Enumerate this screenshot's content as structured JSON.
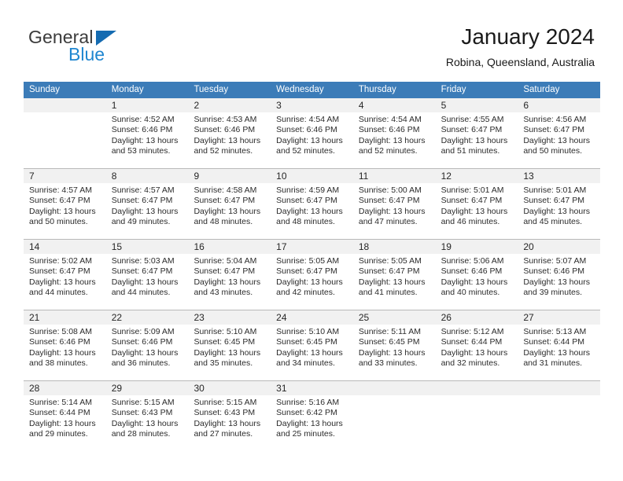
{
  "brand": {
    "word_one": "General",
    "word_two": "Blue",
    "triangle_icon": "blue-triangle-icon",
    "accent_color": "#1f86d0"
  },
  "header": {
    "title": "January 2024",
    "location": "Robina, Queensland, Australia"
  },
  "theme": {
    "header_row_bg": "#3c7cb8",
    "daynum_bg": "#f1f1f1",
    "grid_line": "#b9b9b9",
    "text": "#2b2b2b"
  },
  "weekdays": [
    "Sunday",
    "Monday",
    "Tuesday",
    "Wednesday",
    "Thursday",
    "Friday",
    "Saturday"
  ],
  "weeks": [
    {
      "days": [
        {
          "num": "",
          "sunrise": "",
          "sunset": "",
          "daylight_line1": "",
          "daylight_line2": "",
          "empty": true
        },
        {
          "num": "1",
          "sunrise": "Sunrise: 4:52 AM",
          "sunset": "Sunset: 6:46 PM",
          "daylight_line1": "Daylight: 13 hours",
          "daylight_line2": "and 53 minutes."
        },
        {
          "num": "2",
          "sunrise": "Sunrise: 4:53 AM",
          "sunset": "Sunset: 6:46 PM",
          "daylight_line1": "Daylight: 13 hours",
          "daylight_line2": "and 52 minutes."
        },
        {
          "num": "3",
          "sunrise": "Sunrise: 4:54 AM",
          "sunset": "Sunset: 6:46 PM",
          "daylight_line1": "Daylight: 13 hours",
          "daylight_line2": "and 52 minutes."
        },
        {
          "num": "4",
          "sunrise": "Sunrise: 4:54 AM",
          "sunset": "Sunset: 6:46 PM",
          "daylight_line1": "Daylight: 13 hours",
          "daylight_line2": "and 52 minutes."
        },
        {
          "num": "5",
          "sunrise": "Sunrise: 4:55 AM",
          "sunset": "Sunset: 6:47 PM",
          "daylight_line1": "Daylight: 13 hours",
          "daylight_line2": "and 51 minutes."
        },
        {
          "num": "6",
          "sunrise": "Sunrise: 4:56 AM",
          "sunset": "Sunset: 6:47 PM",
          "daylight_line1": "Daylight: 13 hours",
          "daylight_line2": "and 50 minutes."
        }
      ]
    },
    {
      "days": [
        {
          "num": "7",
          "sunrise": "Sunrise: 4:57 AM",
          "sunset": "Sunset: 6:47 PM",
          "daylight_line1": "Daylight: 13 hours",
          "daylight_line2": "and 50 minutes."
        },
        {
          "num": "8",
          "sunrise": "Sunrise: 4:57 AM",
          "sunset": "Sunset: 6:47 PM",
          "daylight_line1": "Daylight: 13 hours",
          "daylight_line2": "and 49 minutes."
        },
        {
          "num": "9",
          "sunrise": "Sunrise: 4:58 AM",
          "sunset": "Sunset: 6:47 PM",
          "daylight_line1": "Daylight: 13 hours",
          "daylight_line2": "and 48 minutes."
        },
        {
          "num": "10",
          "sunrise": "Sunrise: 4:59 AM",
          "sunset": "Sunset: 6:47 PM",
          "daylight_line1": "Daylight: 13 hours",
          "daylight_line2": "and 48 minutes."
        },
        {
          "num": "11",
          "sunrise": "Sunrise: 5:00 AM",
          "sunset": "Sunset: 6:47 PM",
          "daylight_line1": "Daylight: 13 hours",
          "daylight_line2": "and 47 minutes."
        },
        {
          "num": "12",
          "sunrise": "Sunrise: 5:01 AM",
          "sunset": "Sunset: 6:47 PM",
          "daylight_line1": "Daylight: 13 hours",
          "daylight_line2": "and 46 minutes."
        },
        {
          "num": "13",
          "sunrise": "Sunrise: 5:01 AM",
          "sunset": "Sunset: 6:47 PM",
          "daylight_line1": "Daylight: 13 hours",
          "daylight_line2": "and 45 minutes."
        }
      ]
    },
    {
      "days": [
        {
          "num": "14",
          "sunrise": "Sunrise: 5:02 AM",
          "sunset": "Sunset: 6:47 PM",
          "daylight_line1": "Daylight: 13 hours",
          "daylight_line2": "and 44 minutes."
        },
        {
          "num": "15",
          "sunrise": "Sunrise: 5:03 AM",
          "sunset": "Sunset: 6:47 PM",
          "daylight_line1": "Daylight: 13 hours",
          "daylight_line2": "and 44 minutes."
        },
        {
          "num": "16",
          "sunrise": "Sunrise: 5:04 AM",
          "sunset": "Sunset: 6:47 PM",
          "daylight_line1": "Daylight: 13 hours",
          "daylight_line2": "and 43 minutes."
        },
        {
          "num": "17",
          "sunrise": "Sunrise: 5:05 AM",
          "sunset": "Sunset: 6:47 PM",
          "daylight_line1": "Daylight: 13 hours",
          "daylight_line2": "and 42 minutes."
        },
        {
          "num": "18",
          "sunrise": "Sunrise: 5:05 AM",
          "sunset": "Sunset: 6:47 PM",
          "daylight_line1": "Daylight: 13 hours",
          "daylight_line2": "and 41 minutes."
        },
        {
          "num": "19",
          "sunrise": "Sunrise: 5:06 AM",
          "sunset": "Sunset: 6:46 PM",
          "daylight_line1": "Daylight: 13 hours",
          "daylight_line2": "and 40 minutes."
        },
        {
          "num": "20",
          "sunrise": "Sunrise: 5:07 AM",
          "sunset": "Sunset: 6:46 PM",
          "daylight_line1": "Daylight: 13 hours",
          "daylight_line2": "and 39 minutes."
        }
      ]
    },
    {
      "days": [
        {
          "num": "21",
          "sunrise": "Sunrise: 5:08 AM",
          "sunset": "Sunset: 6:46 PM",
          "daylight_line1": "Daylight: 13 hours",
          "daylight_line2": "and 38 minutes."
        },
        {
          "num": "22",
          "sunrise": "Sunrise: 5:09 AM",
          "sunset": "Sunset: 6:46 PM",
          "daylight_line1": "Daylight: 13 hours",
          "daylight_line2": "and 36 minutes."
        },
        {
          "num": "23",
          "sunrise": "Sunrise: 5:10 AM",
          "sunset": "Sunset: 6:45 PM",
          "daylight_line1": "Daylight: 13 hours",
          "daylight_line2": "and 35 minutes."
        },
        {
          "num": "24",
          "sunrise": "Sunrise: 5:10 AM",
          "sunset": "Sunset: 6:45 PM",
          "daylight_line1": "Daylight: 13 hours",
          "daylight_line2": "and 34 minutes."
        },
        {
          "num": "25",
          "sunrise": "Sunrise: 5:11 AM",
          "sunset": "Sunset: 6:45 PM",
          "daylight_line1": "Daylight: 13 hours",
          "daylight_line2": "and 33 minutes."
        },
        {
          "num": "26",
          "sunrise": "Sunrise: 5:12 AM",
          "sunset": "Sunset: 6:44 PM",
          "daylight_line1": "Daylight: 13 hours",
          "daylight_line2": "and 32 minutes."
        },
        {
          "num": "27",
          "sunrise": "Sunrise: 5:13 AM",
          "sunset": "Sunset: 6:44 PM",
          "daylight_line1": "Daylight: 13 hours",
          "daylight_line2": "and 31 minutes."
        }
      ]
    },
    {
      "days": [
        {
          "num": "28",
          "sunrise": "Sunrise: 5:14 AM",
          "sunset": "Sunset: 6:44 PM",
          "daylight_line1": "Daylight: 13 hours",
          "daylight_line2": "and 29 minutes."
        },
        {
          "num": "29",
          "sunrise": "Sunrise: 5:15 AM",
          "sunset": "Sunset: 6:43 PM",
          "daylight_line1": "Daylight: 13 hours",
          "daylight_line2": "and 28 minutes."
        },
        {
          "num": "30",
          "sunrise": "Sunrise: 5:15 AM",
          "sunset": "Sunset: 6:43 PM",
          "daylight_line1": "Daylight: 13 hours",
          "daylight_line2": "and 27 minutes."
        },
        {
          "num": "31",
          "sunrise": "Sunrise: 5:16 AM",
          "sunset": "Sunset: 6:42 PM",
          "daylight_line1": "Daylight: 13 hours",
          "daylight_line2": "and 25 minutes."
        },
        {
          "num": "",
          "sunrise": "",
          "sunset": "",
          "daylight_line1": "",
          "daylight_line2": "",
          "empty": true
        },
        {
          "num": "",
          "sunrise": "",
          "sunset": "",
          "daylight_line1": "",
          "daylight_line2": "",
          "empty": true
        },
        {
          "num": "",
          "sunrise": "",
          "sunset": "",
          "daylight_line1": "",
          "daylight_line2": "",
          "empty": true
        }
      ]
    }
  ]
}
